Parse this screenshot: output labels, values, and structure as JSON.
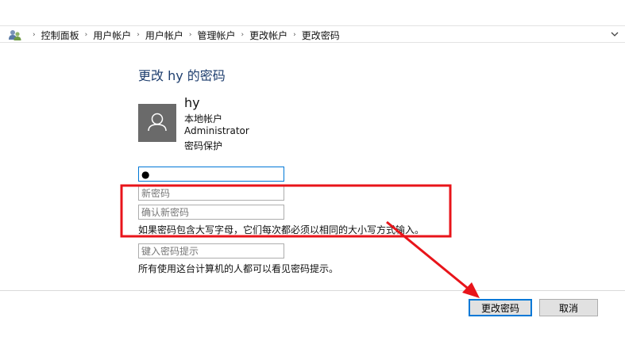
{
  "breadcrumb": {
    "items": [
      "控制面板",
      "用户帐户",
      "用户帐户",
      "管理帐户",
      "更改帐户",
      "更改密码"
    ],
    "separator": "›"
  },
  "icons": {
    "address_icon": "control-panel-users-icon",
    "dropdown": "chevron-down-icon",
    "avatar": "user-icon"
  },
  "page": {
    "title": "更改 hy 的密码"
  },
  "account": {
    "name": "hy",
    "type": "本地帐户",
    "role": "Administrator",
    "protection": "密码保护"
  },
  "form": {
    "current_password_value": "●",
    "new_password_placeholder": "新密码",
    "confirm_password_placeholder": "确认新密码",
    "case_hint": "如果密码包含大写字母，它们每次都必须以相同的大小写方式输入。",
    "hint_placeholder": "键入密码提示",
    "hint_note": "所有使用这台计算机的人都可以看见密码提示。"
  },
  "buttons": {
    "change_password": "更改密码",
    "cancel": "取消"
  },
  "colors": {
    "title": "#1e3e6e",
    "annotation": "#e8141a",
    "focus": "#0078d7"
  }
}
